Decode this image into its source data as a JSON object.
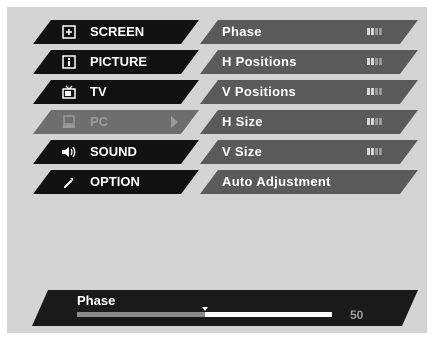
{
  "main_menu": {
    "items": [
      {
        "label": "SCREEN",
        "icon": "screen-icon",
        "selected": false
      },
      {
        "label": "PICTURE",
        "icon": "picture-icon",
        "selected": false
      },
      {
        "label": "TV",
        "icon": "tv-icon",
        "selected": false
      },
      {
        "label": "PC",
        "icon": "pc-icon",
        "selected": true
      },
      {
        "label": "SOUND",
        "icon": "speaker-icon",
        "selected": false
      },
      {
        "label": "OPTION",
        "icon": "wrench-icon",
        "selected": false
      }
    ]
  },
  "sub_menu": {
    "items": [
      {
        "label": "Phase",
        "has_level": true
      },
      {
        "label": "H Positions",
        "has_level": true
      },
      {
        "label": "V Positions",
        "has_level": true
      },
      {
        "label": "H Size",
        "has_level": true
      },
      {
        "label": "V Size",
        "has_level": true
      },
      {
        "label": "Auto Adjustment",
        "has_level": false
      }
    ]
  },
  "adjust_bar": {
    "title": "Phase",
    "value": "50",
    "level_fraction": 0.5
  },
  "colors": {
    "background": "#d4d4d4",
    "menu_item": "#111111",
    "menu_item_selected": "#6e6e6e",
    "sub_item": "#5a5a5a",
    "bar_background": "#1a1a1a"
  }
}
